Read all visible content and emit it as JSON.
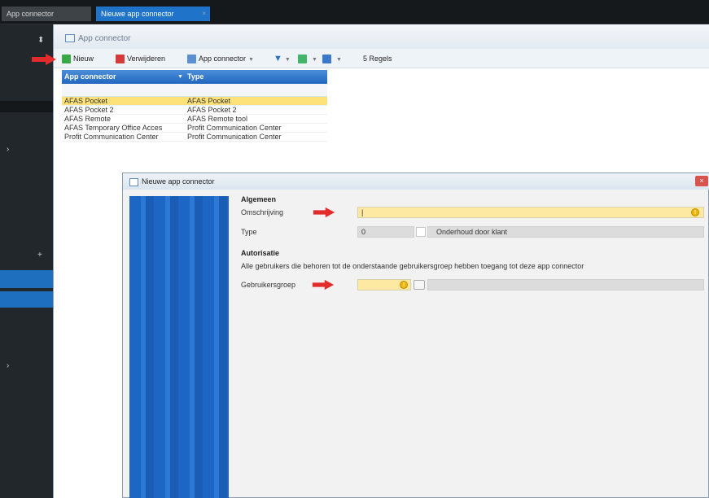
{
  "top_tabs": [
    {
      "label": "App connector"
    },
    {
      "label": "Nieuwe app connector",
      "close": "×"
    }
  ],
  "window": {
    "title": "App connector",
    "toolbar": {
      "new_label": "Nieuw",
      "delete_label": "Verwijderen",
      "app_connector_label": "App connector",
      "count_label": "5 Regels"
    }
  },
  "grid": {
    "columns": [
      "App connector",
      "Type"
    ],
    "rows": [
      {
        "name": "AFAS Pocket",
        "type": "AFAS Pocket",
        "selected": true
      },
      {
        "name": "AFAS Pocket 2",
        "type": "AFAS Pocket 2",
        "selected": false
      },
      {
        "name": "AFAS Remote",
        "type": "AFAS Remote tool",
        "selected": false
      },
      {
        "name": "AFAS Temporary Office Acces",
        "type": "Profit Communication Center",
        "selected": false
      },
      {
        "name": "Profit Communication Center",
        "type": "Profit Communication Center",
        "selected": false
      }
    ]
  },
  "dialog": {
    "title": "Nieuwe app connector",
    "close": "×",
    "general_heading": "Algemeen",
    "description_label": "Omschrijving",
    "type_label": "Type",
    "type_value": "0",
    "client_label": "Onderhoud door klant",
    "auth_heading": "Autorisatie",
    "auth_text": "Alle gebruikers die behoren tot de onderstaande gebruikersgroep hebben toegang tot deze app connector",
    "usergroup_label": "Gebruikersgroep",
    "description_value": "|"
  },
  "colors": {
    "accent": "#1f73c9",
    "selected_row": "#fde27a",
    "required_field": "#fde9a2",
    "annotation_arrow": "#e32b2b"
  }
}
